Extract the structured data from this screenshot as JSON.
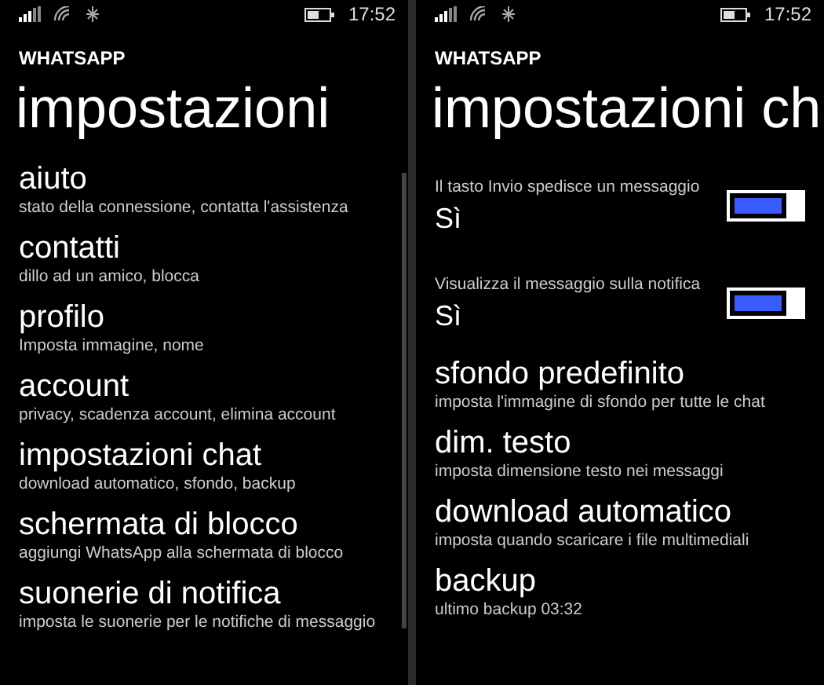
{
  "screens": [
    {
      "status_bar": {
        "time": "17:52"
      },
      "app_title": "WHATSAPP",
      "page_title": "impostazioni",
      "scrollbar": true,
      "items": [
        {
          "kind": "link",
          "title": "aiuto",
          "subtitle": "stato della connessione, contatta l'assistenza"
        },
        {
          "kind": "link",
          "title": "contatti",
          "subtitle": "dillo ad un amico, blocca"
        },
        {
          "kind": "link",
          "title": "profilo",
          "subtitle": "Imposta immagine, nome"
        },
        {
          "kind": "link",
          "title": "account",
          "subtitle": "privacy, scadenza account, elimina account"
        },
        {
          "kind": "link",
          "title": "impostazioni chat",
          "subtitle": "download automatico, sfondo, backup"
        },
        {
          "kind": "link",
          "title": "schermata di blocco",
          "subtitle": "aggiungi WhatsApp alla schermata di blocco"
        },
        {
          "kind": "link",
          "title": "suonerie di notifica",
          "subtitle": "imposta le suonerie per le notifiche di messaggio"
        }
      ]
    },
    {
      "status_bar": {
        "time": "17:52"
      },
      "app_title": "WHATSAPP",
      "page_title": "impostazioni ch",
      "scrollbar": false,
      "items": [
        {
          "kind": "toggle",
          "label": "Il tasto Invio spedisce un messaggio",
          "value": "Sì",
          "on": true
        },
        {
          "kind": "toggle",
          "label": "Visualizza il messaggio sulla notifica",
          "value": "Sì",
          "on": true
        },
        {
          "kind": "link",
          "title": "sfondo predefinito",
          "subtitle": "imposta l'immagine di sfondo per tutte le chat"
        },
        {
          "kind": "link",
          "title": "dim. testo",
          "subtitle": "imposta dimensione testo nei messaggi"
        },
        {
          "kind": "link",
          "title": "download automatico",
          "subtitle": "imposta quando scaricare i file multimediali"
        },
        {
          "kind": "link",
          "title": "backup",
          "subtitle": "ultimo backup 03:32"
        }
      ]
    }
  ]
}
